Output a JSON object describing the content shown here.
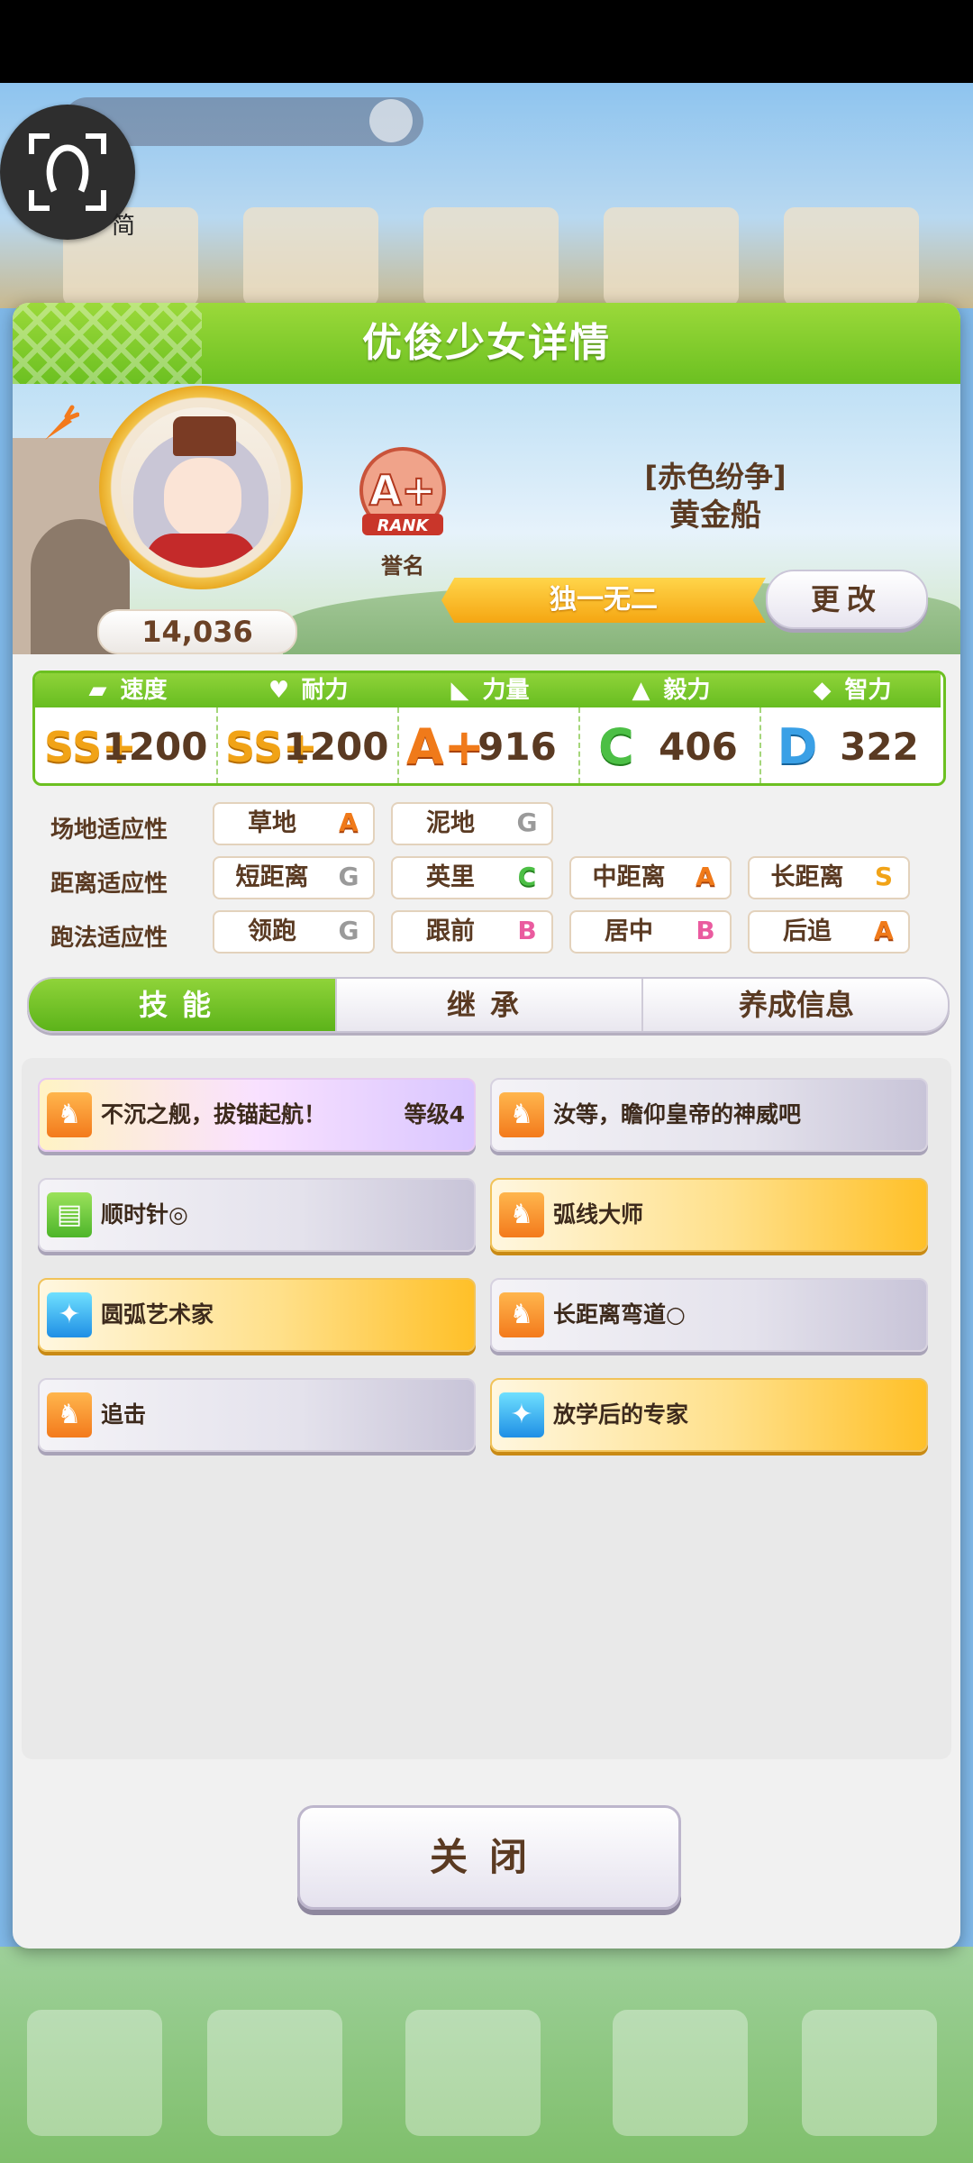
{
  "lens": {
    "label": "简"
  },
  "dialog": {
    "title": "优俊少女详情",
    "score": "14,036",
    "rank": {
      "grade": "A+",
      "caption": "誉名"
    },
    "character": {
      "title": "[赤色纷争]",
      "name": "黄金船"
    },
    "epithet": "独一无二",
    "change_label": "更改"
  },
  "stats": [
    {
      "name": "速度",
      "icon": "speed-icon",
      "grade": "SS+",
      "value": "1200"
    },
    {
      "name": "耐力",
      "icon": "heart-icon",
      "grade": "SS+",
      "value": "1200"
    },
    {
      "name": "力量",
      "icon": "muscle-icon",
      "grade": "A+",
      "value": "916"
    },
    {
      "name": "毅力",
      "icon": "flame-icon",
      "grade": "C",
      "value": "406"
    },
    {
      "name": "智力",
      "icon": "graduation-cap-icon",
      "grade": "D",
      "value": "322"
    }
  ],
  "aptitude": {
    "track": {
      "label": "场地适应性",
      "items": [
        {
          "name": "草地",
          "grade": "A"
        },
        {
          "name": "泥地",
          "grade": "G"
        }
      ]
    },
    "distance": {
      "label": "距离适应性",
      "items": [
        {
          "name": "短距离",
          "grade": "G"
        },
        {
          "name": "英里",
          "grade": "C"
        },
        {
          "name": "中距离",
          "grade": "A"
        },
        {
          "name": "长距离",
          "grade": "S"
        }
      ]
    },
    "strategy": {
      "label": "跑法适应性",
      "items": [
        {
          "name": "领跑",
          "grade": "G"
        },
        {
          "name": "跟前",
          "grade": "B"
        },
        {
          "name": "居中",
          "grade": "B"
        },
        {
          "name": "后追",
          "grade": "A"
        }
      ]
    }
  },
  "tabs": [
    "技能",
    "继承",
    "养成信息"
  ],
  "skills": [
    {
      "name": "不沉之舰，拔锚起航！",
      "level": "等级4",
      "style": "rainbow",
      "icon": "running-horse-icon"
    },
    {
      "name": "汝等，瞻仰皇帝的神威吧",
      "level": "",
      "style": "white",
      "icon": "running-horse-icon"
    },
    {
      "name": "顺时针◎",
      "level": "",
      "style": "white",
      "icon": "green-card-icon"
    },
    {
      "name": "弧线大师",
      "level": "",
      "style": "gold",
      "icon": "running-horse-icon"
    },
    {
      "name": "圆弧艺术家",
      "level": "",
      "style": "gold",
      "icon": "sparkle-icon"
    },
    {
      "name": "长距离弯道○",
      "level": "",
      "style": "white",
      "icon": "running-horse-icon"
    },
    {
      "name": "追击",
      "level": "",
      "style": "white",
      "icon": "running-horse-icon"
    },
    {
      "name": "放学后的专家",
      "level": "",
      "style": "gold",
      "icon": "sparkle-icon"
    }
  ],
  "close_label": "关闭"
}
